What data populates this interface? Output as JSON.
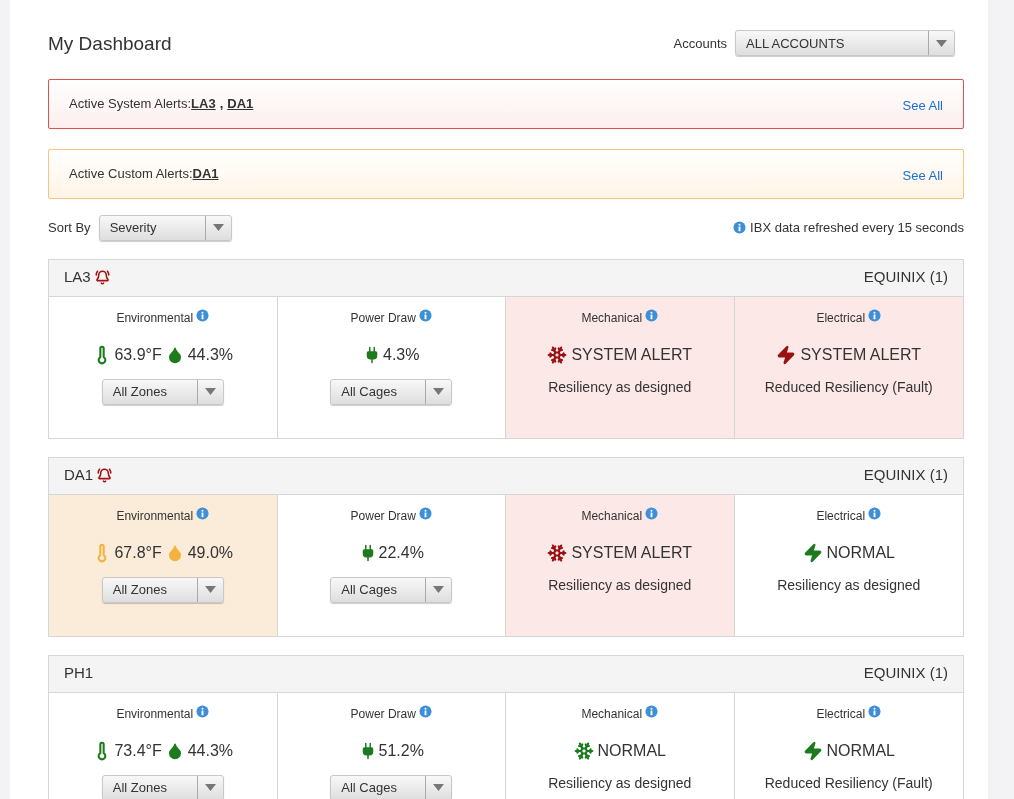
{
  "title": "My Dashboard",
  "accounts": {
    "label": "Accounts",
    "value": "ALL ACCOUNTS"
  },
  "alerts": [
    {
      "kind": "system",
      "label": "Active System Alerts:",
      "links": [
        "LA3",
        "DA1"
      ],
      "separator": ",",
      "see_all": "See All"
    },
    {
      "kind": "custom",
      "label": "Active Custom Alerts:",
      "links": [
        "DA1"
      ],
      "see_all": "See All"
    }
  ],
  "sort": {
    "label": "Sort By",
    "value": "Severity"
  },
  "refresh_note": "IBX data refreshed every 15 seconds",
  "sites": [
    {
      "name": "LA3",
      "alarm": true,
      "provider": "EQUINIX (1)",
      "cells": [
        {
          "kind": "environmental",
          "title": "Environmental",
          "alert": false,
          "warning": false,
          "temperature": "63.9°F",
          "humidity": "44.3%",
          "dropdown": "All Zones"
        },
        {
          "kind": "power",
          "title": "Power Draw",
          "alert": false,
          "warning": false,
          "reading": "4.3%",
          "dropdown": "All Cages"
        },
        {
          "kind": "mechanical",
          "title": "Mechanical",
          "alert": true,
          "warning": false,
          "state": "SYSTEM ALERT",
          "resiliency": "Resiliency as designed"
        },
        {
          "kind": "electrical",
          "title": "Electrical",
          "alert": true,
          "warning": false,
          "state": "SYSTEM ALERT",
          "resiliency": "Reduced Resiliency (Fault)"
        }
      ]
    },
    {
      "name": "DA1",
      "alarm": true,
      "provider": "EQUINIX (1)",
      "cells": [
        {
          "kind": "environmental",
          "title": "Environmental",
          "alert": false,
          "warning": true,
          "temperature": "67.8°F",
          "humidity": "49.0%",
          "dropdown": "All Zones"
        },
        {
          "kind": "power",
          "title": "Power Draw",
          "alert": false,
          "warning": false,
          "reading": "22.4%",
          "dropdown": "All Cages"
        },
        {
          "kind": "mechanical",
          "title": "Mechanical",
          "alert": true,
          "warning": false,
          "state": "SYSTEM ALERT",
          "resiliency": "Resiliency as designed"
        },
        {
          "kind": "electrical",
          "title": "Electrical",
          "alert": false,
          "warning": false,
          "state": "NORMAL",
          "resiliency": "Resiliency as designed"
        }
      ]
    },
    {
      "name": "PH1",
      "alarm": false,
      "provider": "EQUINIX (1)",
      "cells": [
        {
          "kind": "environmental",
          "title": "Environmental",
          "alert": false,
          "warning": false,
          "temperature": "73.4°F",
          "humidity": "44.3%",
          "dropdown": "All Zones"
        },
        {
          "kind": "power",
          "title": "Power Draw",
          "alert": false,
          "warning": false,
          "reading": "51.2%",
          "dropdown": "All Cages"
        },
        {
          "kind": "mechanical",
          "title": "Mechanical",
          "alert": false,
          "warning": false,
          "state": "NORMAL",
          "resiliency": "Resiliency as designed"
        },
        {
          "kind": "electrical",
          "title": "Electrical",
          "alert": false,
          "warning": false,
          "state": "NORMAL",
          "resiliency": "Reduced Resiliency (Fault)"
        }
      ]
    }
  ]
}
